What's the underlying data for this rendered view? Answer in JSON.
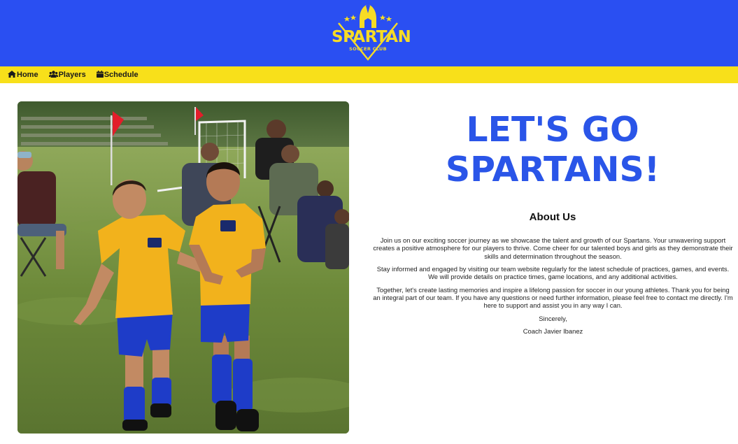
{
  "header": {
    "logo_word": "SPARTAN",
    "logo_sub": "SOCCER CLUB",
    "brand_color": "#2a4ff2",
    "accent_color": "#f7dc25"
  },
  "nav": {
    "items": [
      {
        "label": "Home",
        "icon": "home-icon"
      },
      {
        "label": "Players",
        "icon": "users-icon"
      },
      {
        "label": "Schedule",
        "icon": "calendar-icon"
      }
    ]
  },
  "hero": {
    "line1": "LET'S GO",
    "line2": "SPARTANS!"
  },
  "about": {
    "title": "About Us",
    "paragraphs": [
      "Join us on our exciting soccer journey as we showcase the talent and growth of our Spartans. Your unwavering support creates a positive atmosphere for our players to thrive. Come cheer for our talented boys and girls as they demonstrate their skills and determination throughout the season.",
      "Stay informed and engaged by visiting our team website regularly for the latest schedule of practices, games, and events. We will provide details on practice times, game locations, and any additional activities.",
      "Together, let's create lasting memories and inspire a lifelong passion for soccer in our young athletes. Thank you for being an integral part of our team. If you have any questions or need further information, please feel free to contact me directly. I'm here to support and assist you in any way I can.",
      "Sincerely,",
      "Coach Javier Ibanez"
    ]
  }
}
